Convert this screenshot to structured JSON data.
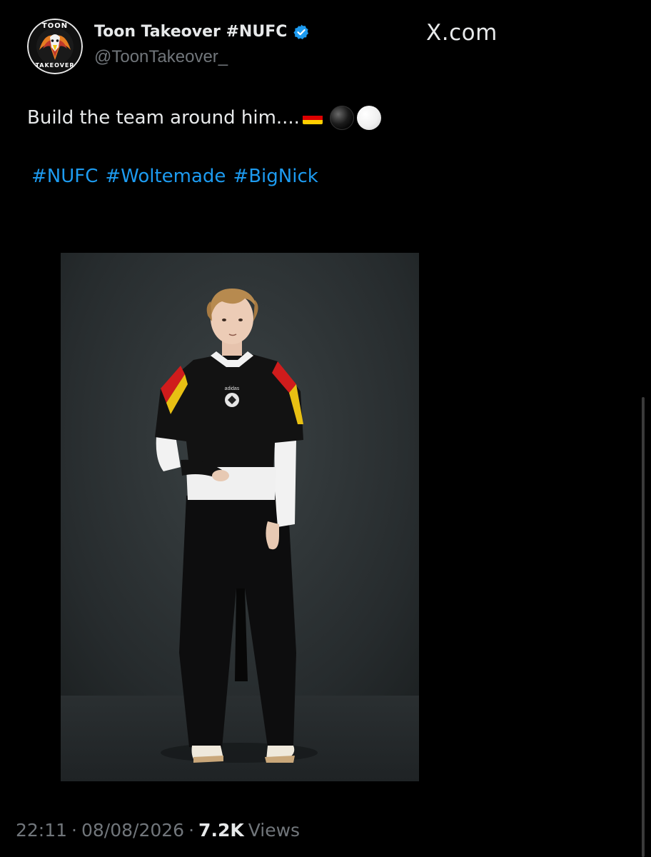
{
  "author": {
    "display_name": "Toon Takeover #NUFC",
    "handle": "@ToonTakeover_",
    "verified": true,
    "avatar_ring_top": "TOON",
    "avatar_ring_bottom": "TAKEOVER",
    "verified_color": "#1d9bf0"
  },
  "site_label": "X.com",
  "tweet": {
    "text": "Build the team around him....",
    "emojis": [
      "germany-flag",
      "black-circle",
      "white-circle"
    ],
    "hashtags": [
      "#NUFC",
      "#Woltemade",
      "#BigNick"
    ]
  },
  "media": {
    "logo": "adidas",
    "badge": "federal-eagle-crest"
  },
  "meta": {
    "time": "22:11",
    "separator": "·",
    "date": "08/08/2026",
    "views_count": "7.2K",
    "views_label": "Views"
  },
  "colors": {
    "background": "#000000",
    "text_primary": "#e7e9ea",
    "text_secondary": "#71767b",
    "link": "#1d9bf0"
  }
}
